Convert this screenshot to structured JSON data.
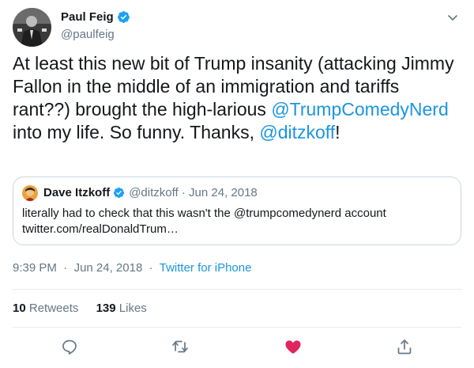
{
  "tweet": {
    "author": {
      "display_name": "Paul Feig",
      "handle": "@paulfeig",
      "verified": true
    },
    "text_segments": [
      {
        "text": "At least this new bit of Trump insanity (attacking Jimmy Fallon in the middle of an immigration and tariffs rant??) brought the high-larious ",
        "type": "text"
      },
      {
        "text": "@TrumpComedyNerd",
        "type": "mention"
      },
      {
        "text": " into my life. So funny. Thanks, ",
        "type": "text"
      },
      {
        "text": "@ditzkoff",
        "type": "mention"
      },
      {
        "text": "!",
        "type": "text"
      }
    ],
    "quoted": {
      "display_name": "Dave Itzkoff",
      "handle": "@ditzkoff",
      "separator": "·",
      "date": "Jun 24, 2018",
      "line1": "literally had to check that this wasn't the @trumpcomedynerd account",
      "line2": "twitter.com/realDonaldTrum…"
    },
    "meta": {
      "time": "9:39 PM",
      "separator": "·",
      "date": "Jun 24, 2018",
      "source": "Twitter for iPhone"
    },
    "stats": {
      "retweets_count": "10",
      "retweets_label": "Retweets",
      "likes_count": "139",
      "likes_label": "Likes"
    },
    "actions": [
      "reply-icon",
      "retweet-icon",
      "like-icon",
      "share-icon"
    ],
    "colors": {
      "link": "#1b95e0",
      "secondary_text": "#657786",
      "like_active": "#e0245e",
      "action_icon": "#657786",
      "border": "#ccd6dd"
    }
  }
}
